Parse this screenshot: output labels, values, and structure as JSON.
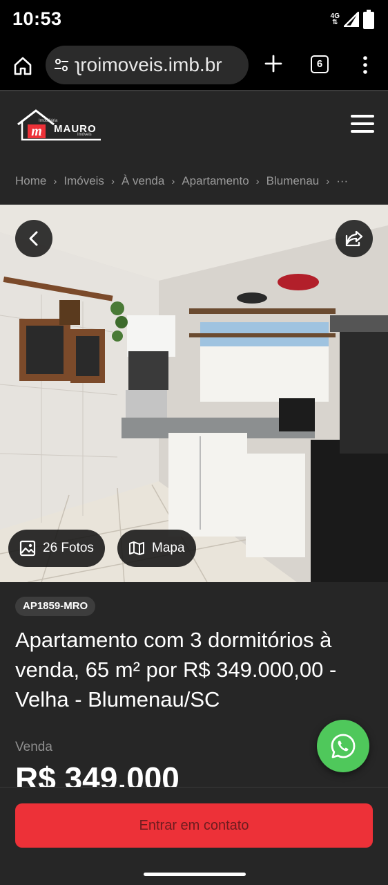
{
  "status_bar": {
    "time": "10:53",
    "network": "4G"
  },
  "browser": {
    "url": "ʅroimoveis.imb.br",
    "tab_count": "6"
  },
  "site": {
    "logo_small": "Imobiliária",
    "logo_name": "MAURO",
    "logo_sub": "Imóveis"
  },
  "breadcrumb": {
    "items": [
      "Home",
      "Imóveis",
      "À venda",
      "Apartamento",
      "Blumenau"
    ],
    "separator": "›",
    "more": "···"
  },
  "gallery": {
    "photos_label": "26 Fotos",
    "map_label": "Mapa"
  },
  "listing": {
    "code": "AP1859-MRO",
    "title": "Apartamento com 3 dormitórios à venda, 65 m² por R$ 349.000,00 - Velha - Blumenau/SC",
    "sale_label": "Venda",
    "price": "R$ 349.000"
  },
  "cta": {
    "contact_label": "Entrar em contato"
  },
  "colors": {
    "accent": "#ed3138",
    "whatsapp": "#4fc85b",
    "background": "#262626"
  }
}
